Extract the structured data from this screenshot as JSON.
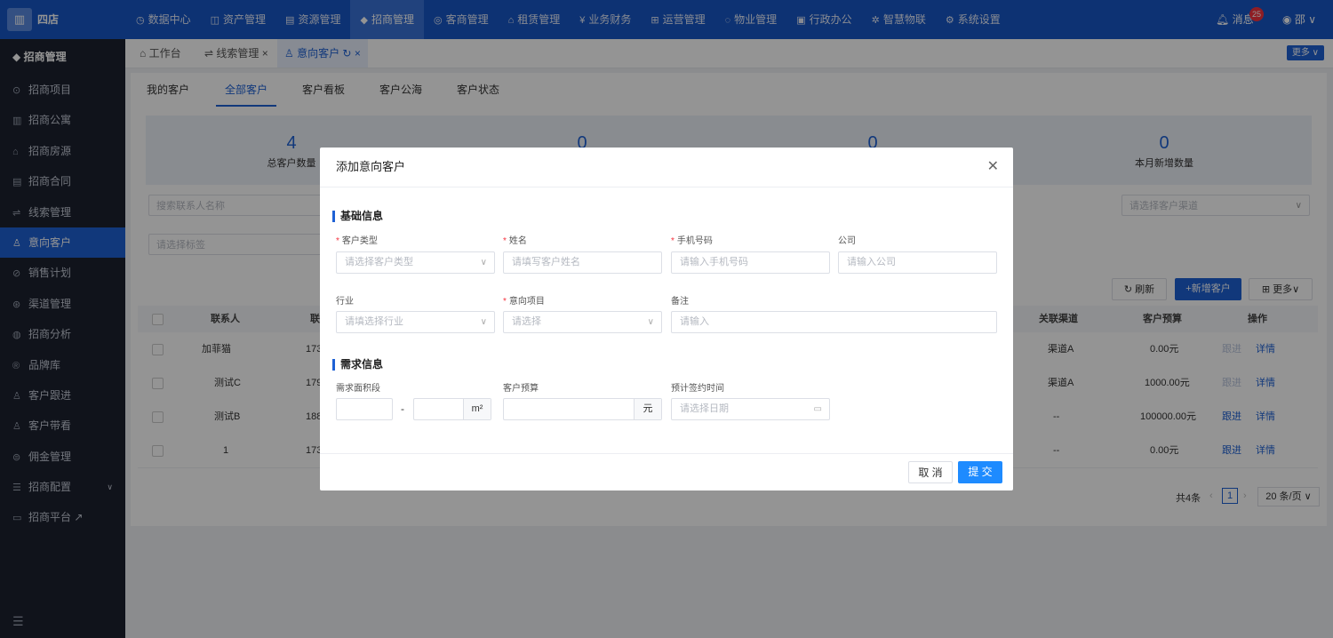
{
  "topbar": {
    "brand": "四店",
    "nav": [
      {
        "icon": "◷",
        "label": "数据中心"
      },
      {
        "icon": "◫",
        "label": "资产管理"
      },
      {
        "icon": "▤",
        "label": "资源管理"
      },
      {
        "icon": "◆",
        "label": "招商管理"
      },
      {
        "icon": "◎",
        "label": "客商管理"
      },
      {
        "icon": "⌂",
        "label": "租赁管理"
      },
      {
        "icon": "¥",
        "label": "业务财务"
      },
      {
        "icon": "⊞",
        "label": "运营管理"
      },
      {
        "icon": "◌",
        "label": "物业管理"
      },
      {
        "icon": "▣",
        "label": "行政办公"
      },
      {
        "icon": "✲",
        "label": "智慧物联"
      },
      {
        "icon": "⚙",
        "label": "系统设置"
      }
    ],
    "messages_label": "消息",
    "messages_count": "25",
    "user": "邵"
  },
  "sidebar": {
    "title": "招商管理",
    "items": [
      {
        "icon": "⊙",
        "label": "招商项目"
      },
      {
        "icon": "▥",
        "label": "招商公寓"
      },
      {
        "icon": "⌂",
        "label": "招商房源"
      },
      {
        "icon": "▤",
        "label": "招商合同"
      },
      {
        "icon": "⇌",
        "label": "线索管理"
      },
      {
        "icon": "♙",
        "label": "意向客户"
      },
      {
        "icon": "⊘",
        "label": "销售计划"
      },
      {
        "icon": "⊛",
        "label": "渠道管理"
      },
      {
        "icon": "◍",
        "label": "招商分析"
      },
      {
        "icon": "®",
        "label": "品牌库"
      },
      {
        "icon": "♙",
        "label": "客户跟进"
      },
      {
        "icon": "♙",
        "label": "客户带看"
      },
      {
        "icon": "⊜",
        "label": "佣金管理"
      },
      {
        "icon": "☰",
        "label": "招商配置"
      },
      {
        "icon": "▭",
        "label": "招商平台 ↗"
      }
    ]
  },
  "tabs": [
    {
      "label": "⌂ 工作台"
    },
    {
      "label": "⇌ 线索管理 ×"
    },
    {
      "label": "♙ 意向客户 ↻ ×"
    }
  ],
  "tabs_more": "更多 ∨",
  "subtabs": [
    "我的客户",
    "全部客户",
    "客户看板",
    "客户公海",
    "客户状态"
  ],
  "stats": [
    {
      "num": "4",
      "label": "总客户数量"
    },
    {
      "num": "0",
      "label": ""
    },
    {
      "num": "0",
      "label": ""
    },
    {
      "num": "0",
      "label": "本月新增数量"
    }
  ],
  "filters": {
    "contact_name": "搜索联系人名称",
    "tags": "请选择标签",
    "channel": "请选择客户渠道"
  },
  "actions": {
    "refresh": "↻ 刷新",
    "add": "+新增客户",
    "more": "⊞ 更多∨"
  },
  "table": {
    "headers": [
      "联系人",
      "联",
      "关联渠道",
      "客户预算",
      "操作"
    ],
    "rows": [
      {
        "contact": "加菲猫",
        "phone": "173",
        "channel": "渠道A",
        "budget": "0.00元",
        "follow": "跟进",
        "detail": "详情"
      },
      {
        "contact": "测试C",
        "phone": "179",
        "channel": "渠道A",
        "budget": "1000.00元",
        "follow": "跟进",
        "detail": "详情"
      },
      {
        "contact": "测试B",
        "phone": "188",
        "channel": "--",
        "budget": "100000.00元",
        "follow": "跟进",
        "detail": "详情"
      },
      {
        "contact": "1",
        "phone": "173",
        "channel": "--",
        "budget": "0.00元",
        "follow": "跟进",
        "detail": "详情"
      }
    ]
  },
  "pager": {
    "total": "共4条",
    "page": "1",
    "size": "20 条/页 ∨"
  },
  "modal": {
    "title": "添加意向客户",
    "section_basic": "基础信息",
    "section_demand": "需求信息",
    "fields": {
      "customer_type": {
        "label": "客户类型",
        "placeholder": "请选择客户类型"
      },
      "name": {
        "label": "姓名",
        "placeholder": "请填写客户姓名"
      },
      "phone": {
        "label": "手机号码",
        "placeholder": "请输入手机号码"
      },
      "company": {
        "label": "公司",
        "placeholder": "请输入公司"
      },
      "industry": {
        "label": "行业",
        "placeholder": "请填选择行业"
      },
      "project": {
        "label": "意向项目",
        "placeholder": "请选择"
      },
      "remark": {
        "label": "备注",
        "placeholder": "请输入"
      },
      "area": {
        "label": "需求面积段",
        "unit": "m²",
        "dash": "-"
      },
      "budget": {
        "label": "客户预算",
        "unit": "元"
      },
      "sign_date": {
        "label": "预计签约时间",
        "placeholder": "请选择日期"
      }
    },
    "cancel": "取 消",
    "submit": "提 交"
  },
  "colors": {
    "primary": "#1e61d5",
    "topbar": "#1857c6",
    "sidebar": "#1c2230",
    "required": "#f5333f"
  }
}
